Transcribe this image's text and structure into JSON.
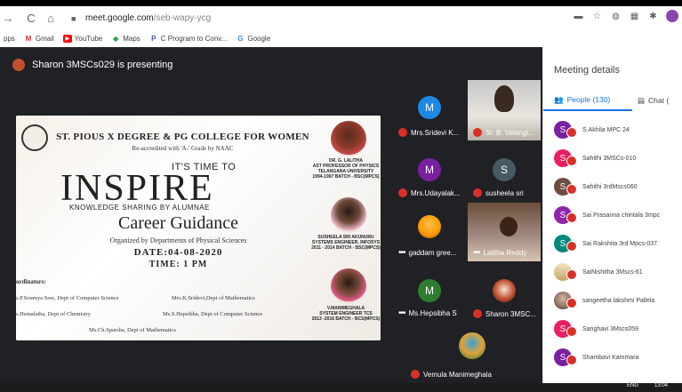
{
  "browser": {
    "url_host": "meet.google.com",
    "url_path": "/seb-wapy-ycg",
    "bookmarks": [
      {
        "icon": "apps-icon",
        "label": "pps"
      },
      {
        "icon": "gmail-icon",
        "label": "Gmail"
      },
      {
        "icon": "youtube-icon",
        "label": "YouTube"
      },
      {
        "icon": "maps-icon",
        "label": "Maps"
      },
      {
        "icon": "c-program-icon",
        "label": "C Program to Conv..."
      },
      {
        "icon": "google-icon",
        "label": "Google"
      }
    ]
  },
  "presenting": {
    "text": "Sharon 3MSCs029 is presenting"
  },
  "slide": {
    "college": "ST. PIOUS X DEGREE & PG COLLEGE FOR WOMEN",
    "accreditation": "Re-accredited with 'A-' Grade by NAAC",
    "time_to": "IT'S TIME TO",
    "inspire": "INSPIRE",
    "knowledge": "KNOWLEDGE SHARING BY ALUMNAE",
    "career": "Career Guidance",
    "organized": "Organized by Departments of Physical Sciences",
    "date": "DATE:04-08-2020",
    "time": "TIME: 1 PM",
    "coordinators_title": "ordinators:",
    "coordinators": [
      "s.P.Soumya Sree, Dept of Computer Science",
      "Mrs.K.Sridevi,Dept of Mathematics",
      "s.Hemalatha, Dept of Chemistry",
      "Ms.S.Hepsibha, Dept of Computer Science",
      "Ms.Ch.Sparsha, Dept of Mathematics"
    ],
    "speakers": [
      {
        "line1": "DR. G. LALITHA",
        "line2": "AST PROFESSOR OF PHYSICS",
        "line3": "TELANGANA UNIVERSITY",
        "line4": "1994-1997 BATCH - BSC(MPCS)"
      },
      {
        "line1": "SUSHEELA SRI AKUNURU",
        "line2": "SYSTEMS ENGINEER, INFOSYS",
        "line3": "2011 - 2014 BATCH - BSC(MPCS)",
        "line4": ""
      },
      {
        "line1": "V.MANIMEGHALA",
        "line2": "SYSTEM ENGINEER TCS",
        "line3": "2013 -2016 BATCH - BCS(MPCS)",
        "line4": ""
      }
    ]
  },
  "tiles": [
    {
      "name": "Mrs.Sridevi K...",
      "initial": "M",
      "color": "#1e88e5"
    },
    {
      "name": "Sr. B. Velangi...",
      "initial": "",
      "color": "#9e9e9e"
    },
    {
      "name": "Mrs.Udayalak...",
      "initial": "M",
      "color": "#7b1fa2"
    },
    {
      "name": "susheela sri",
      "initial": "S",
      "color": "#455a64"
    },
    {
      "name": "gaddam gree...",
      "initial": "",
      "color": "#ff9800"
    },
    {
      "name": "Lalitha Reddy",
      "initial": "",
      "color": "#a1887f"
    },
    {
      "name": "Ms.Hepsibha S",
      "initial": "M",
      "color": "#2e7d32"
    },
    {
      "name": "Sharon 3MSC...",
      "initial": "",
      "color": "#c1502e"
    },
    {
      "name": "Vemula Manimeghala",
      "initial": "",
      "color": "#e0a23a"
    }
  ],
  "panel": {
    "title": "Meeting details",
    "people_tab": "People (130)",
    "chat_tab": "Chat (",
    "people": [
      {
        "initial": "S",
        "name": "S.Akhila MPC 24",
        "color": "#7b1fa2"
      },
      {
        "initial": "S",
        "name": "Sahithi 3MSCs-010",
        "color": "#e91e63"
      },
      {
        "initial": "S",
        "name": "Sahithi 3rdMscs060",
        "color": "#6d4c41"
      },
      {
        "initial": "S",
        "name": "Sai Prasanna chintala 3mpc",
        "color": "#8e24aa"
      },
      {
        "initial": "S",
        "name": "Sai Rakshita 3rd Mpcs-037",
        "color": "#00897b"
      },
      {
        "initial": "",
        "name": "SaiNishitha 3Mscs-61",
        "color": "#d7ccc8"
      },
      {
        "initial": "",
        "name": "sangeetha lakshmi Pallela",
        "color": "#8d6e63"
      },
      {
        "initial": "S",
        "name": "Sanghavi 3Mscs059",
        "color": "#e91e63"
      },
      {
        "initial": "S",
        "name": "Shambavi Kammara",
        "color": "#7b1fa2"
      }
    ]
  },
  "taskbar": {
    "lang": "ENG",
    "clock": "13:04"
  }
}
